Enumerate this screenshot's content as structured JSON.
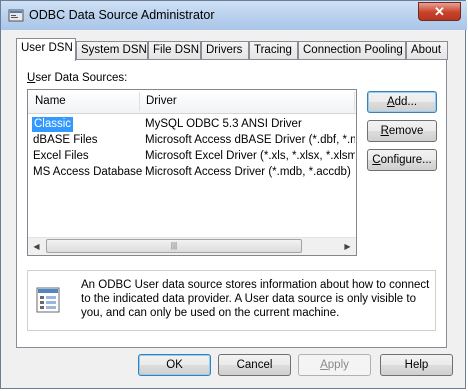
{
  "window": {
    "title": "ODBC Data Source Administrator",
    "close_glyph": "✕"
  },
  "tabs": [
    {
      "label": "User DSN",
      "active": true
    },
    {
      "label": "System DSN"
    },
    {
      "label": "File DSN"
    },
    {
      "label": "Drivers"
    },
    {
      "label": "Tracing"
    },
    {
      "label": "Connection Pooling"
    },
    {
      "label": "About"
    }
  ],
  "user_dsn": {
    "group_label": "User Data Sources:",
    "columns": {
      "name": "Name",
      "driver": "Driver"
    },
    "rows": [
      {
        "name": "Classic",
        "driver": "MySQL ODBC 5.3 ANSI Driver",
        "selected": true
      },
      {
        "name": "dBASE Files",
        "driver": "Microsoft Access dBASE Driver (*.dbf, *.ndx"
      },
      {
        "name": "Excel Files",
        "driver": "Microsoft Excel Driver (*.xls, *.xlsx, *.xlsm, *.x"
      },
      {
        "name": "MS Access Database",
        "driver": "Microsoft Access Driver (*.mdb, *.accdb)"
      }
    ],
    "buttons": {
      "add": "Add...",
      "remove": "Remove",
      "configure": "Configure..."
    },
    "info_text": "An ODBC User data source stores information about how to connect to the indicated data provider.  A User data source is only visible to you, and can only be used on the current machine."
  },
  "footer": {
    "ok": "OK",
    "cancel": "Cancel",
    "apply": "Apply",
    "help": "Help"
  },
  "colors": {
    "selection": "#3399ff",
    "titlebar": "#bcd3ee",
    "close": "#c7422b"
  }
}
